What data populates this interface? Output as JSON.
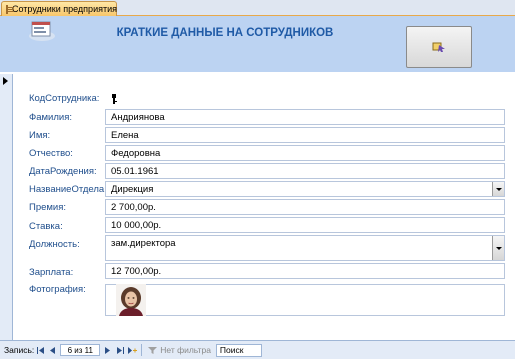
{
  "tab": {
    "title": "Сотрудники предприятия"
  },
  "header": {
    "title": "КРАТКИЕ ДАННЫЕ НА СОТРУДНИКОВ"
  },
  "fields": {
    "kod": {
      "label": "КодСотрудника:",
      "value": ""
    },
    "familiya": {
      "label": "Фамилия:",
      "value": "Андриянова"
    },
    "imya": {
      "label": "Имя:",
      "value": "Елена"
    },
    "otchestvo": {
      "label": "Отчество:",
      "value": "Федоровна"
    },
    "data_rozhd": {
      "label": "ДатаРождения:",
      "value": "05.01.1961"
    },
    "otdel": {
      "label": "НазваниеОтдела:",
      "value": "Дирекция"
    },
    "premiya": {
      "label": "Премия:",
      "value": "2 700,00р."
    },
    "stavka": {
      "label": "Ставка:",
      "value": "10 000,00р."
    },
    "dolzhnost": {
      "label": "Должность:",
      "value": "зам.директора"
    },
    "zarplata": {
      "label": "Зарплата:",
      "value": "12 700,00р."
    },
    "foto": {
      "label": "Фотография:"
    }
  },
  "navbar": {
    "record_label": "Запись:",
    "position": "6 из 11",
    "filter_label": "Нет фильтра",
    "search_label": "Поиск"
  },
  "icons": {
    "tab": "form-tab-icon",
    "form": "form-icon",
    "header_button": "run-macro-icon",
    "record_selector": "record-selector-arrow-icon",
    "key": "key-icon",
    "photo": "employee-photo"
  },
  "colors": {
    "header_bg": "#bcd3f2",
    "title": "#1f5aa6",
    "label": "#1f4e8c",
    "tab": "#f8c66b"
  }
}
